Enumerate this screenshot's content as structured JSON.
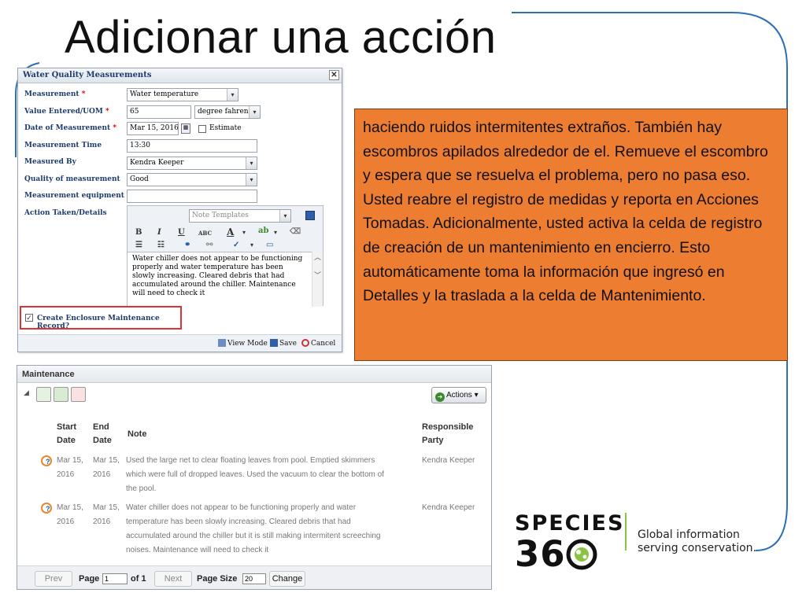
{
  "slide": {
    "title": "Adicionar una acción",
    "callout_text": "haciendo ruidos intermitentes extraños. También hay escombros apilados alrededor de el.  Remueve el escombro y espera que se resuelva el problema, pero no pasa eso. Usted reabre el registro de medidas y reporta en Acciones Tomadas. Adicionalmente, usted activa la celda de registro de creación de un mantenimiento en encierro. Esto automáticamente toma la información que ingresó en Detalles y la traslada a la celda de Mantenimiento."
  },
  "dialog": {
    "title": "Water Quality Measurements",
    "close": "✕",
    "labels": {
      "measurement": "Measurement",
      "value": "Value Entered/UOM",
      "date": "Date of Measurement",
      "time": "Measurement Time",
      "measured_by": "Measured By",
      "quality": "Quality of measurement",
      "equipment": "Measurement equipment",
      "action": "Action Taken/Details",
      "required": "*"
    },
    "values": {
      "measurement": "Water temperature",
      "value": "65",
      "uom": "degree fahren",
      "date": "Mar 15, 2016",
      "estimate": "Estimate",
      "time": "13:30",
      "measured_by": "Kendra Keeper",
      "quality": "Good",
      "equipment": ""
    },
    "editor": {
      "template": "Note Templates",
      "bold": "B",
      "italic": "I",
      "underline": "U",
      "abc": "ABC",
      "font_color": "A",
      "text": "Water chiller does not appear to be functioning properly and water temperature has been slowly increasing. Cleared debris that had accumulated around the chiller. Maintenance will need to check it"
    },
    "enclosure_checkbox": "Create Enclosure Maintenance Record?",
    "footer": {
      "view_mode": "View Mode",
      "save": "Save",
      "cancel": "Cancel"
    }
  },
  "maintenance": {
    "title": "Maintenance",
    "actions": "Actions",
    "columns": {
      "start_a": "Start",
      "start_b": "Date",
      "end_a": "End",
      "end_b": "Date",
      "note": "Note",
      "party_a": "Responsible",
      "party_b": "Party"
    },
    "rows": [
      {
        "start_a": "Mar 15,",
        "start_b": "2016",
        "end_a": "Mar 15,",
        "end_b": "2016",
        "note_1": "Used the large net to clear floating leaves from pool. Emptied skimmers",
        "note_2": "which were full of dropped leaves. Used the vacuum to clear the bottom of",
        "note_3": "the pool.",
        "note_4": "",
        "party": "Kendra Keeper"
      },
      {
        "start_a": "Mar 15,",
        "start_b": "2016",
        "end_a": "Mar 15,",
        "end_b": "2016",
        "note_1": "Water chiller does not appear to be functioning properly and water",
        "note_2": "temperature has been slowly increasing. Cleared debris that had",
        "note_3": "accumulated around the chiller but it is still making intermitent screeching",
        "note_4": "noises. Maintenance will need to check it",
        "party": "Kendra Keeper"
      }
    ],
    "pager": {
      "prev": "Prev",
      "page": "Page",
      "page_value": "1",
      "of": "of 1",
      "next": "Next",
      "page_size": "Page Size",
      "page_size_value": "20",
      "change": "Change"
    }
  },
  "logo": {
    "species": "SPECIES",
    "num_a": "36",
    "tag_1": "Global information",
    "tag_2": "serving conservation."
  }
}
